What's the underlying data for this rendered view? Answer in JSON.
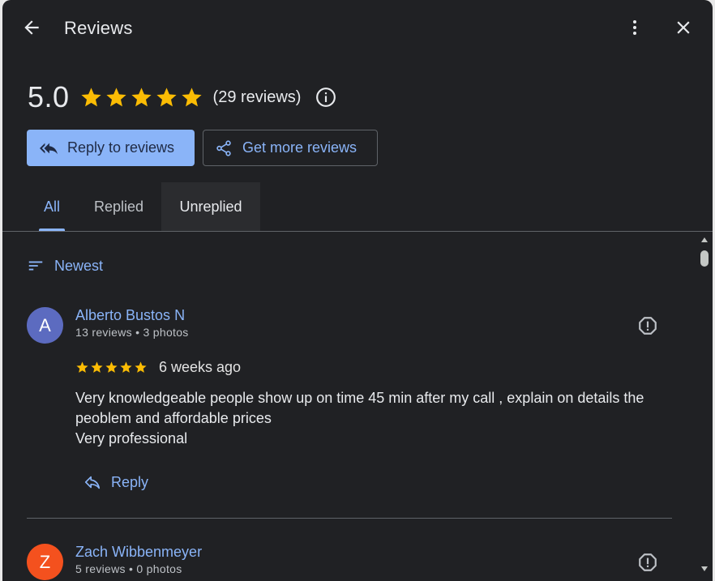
{
  "header": {
    "title": "Reviews",
    "back_icon": "arrow-back-icon",
    "more_icon": "more-vert-icon",
    "close_icon": "close-icon"
  },
  "summary": {
    "rating": "5.0",
    "stars": 5,
    "count_text": "(29 reviews)",
    "info_icon": "info-icon"
  },
  "actions": {
    "reply_label": "Reply to reviews",
    "get_more_label": "Get more reviews"
  },
  "tabs": [
    {
      "label": "All",
      "selected": true
    },
    {
      "label": "Replied",
      "selected": false
    },
    {
      "label": "Unreplied",
      "selected": false
    }
  ],
  "sort": {
    "label": "Newest",
    "icon": "sort-icon"
  },
  "reviews": [
    {
      "initial": "A",
      "avatar_color": "#5c6bc0",
      "name": "Alberto Bustos N",
      "meta": "13 reviews • 3 photos",
      "stars": 5,
      "ago": "6 weeks ago",
      "text_lines": [
        "Very knowledgeable people show up on time 45 min after my call , explain on details the",
        "peoblem and affordable prices",
        "Very professional"
      ],
      "reply_label": "Reply"
    },
    {
      "initial": "Z",
      "avatar_color": "#f4511e",
      "name": "Zach Wibbenmeyer",
      "meta": "5 reviews • 0 photos"
    }
  ],
  "colors": {
    "accent": "#8ab4f8",
    "star": "#fbbc04",
    "background": "#202124"
  }
}
